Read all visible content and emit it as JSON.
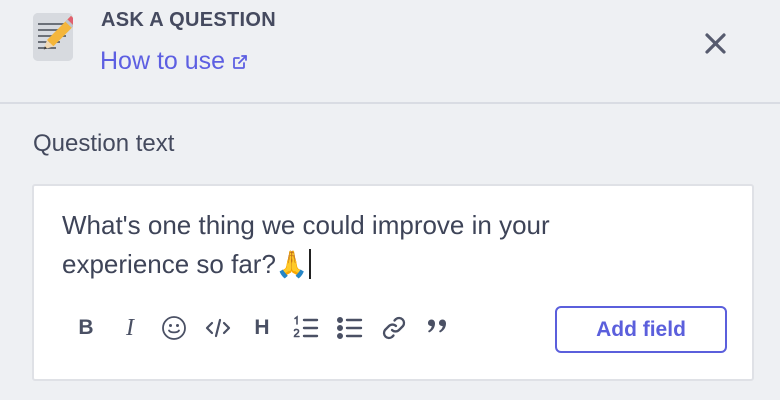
{
  "header": {
    "title": "ASK A QUESTION",
    "help_link": "How to use",
    "app_icon": "memo-pencil-icon",
    "close_icon": "close-icon"
  },
  "form": {
    "field_label": "Question text",
    "question_value": "What's one thing we could improve in your experience so far?🙏",
    "toolbar": [
      {
        "name": "bold",
        "icon": "bold-icon"
      },
      {
        "name": "italic",
        "icon": "italic-icon"
      },
      {
        "name": "emoji",
        "icon": "emoji-icon"
      },
      {
        "name": "code",
        "icon": "code-icon"
      },
      {
        "name": "heading",
        "icon": "heading-icon"
      },
      {
        "name": "ordered-list",
        "icon": "ordered-list-icon"
      },
      {
        "name": "bullet-list",
        "icon": "bullet-list-icon"
      },
      {
        "name": "link",
        "icon": "link-icon"
      },
      {
        "name": "quote",
        "icon": "quote-icon"
      }
    ],
    "toolbar_glyphs": {
      "bold": "B",
      "italic": "I",
      "heading": "H"
    },
    "add_field_label": "Add field"
  },
  "colors": {
    "accent": "#5b5fdc",
    "link": "#5d5fe2",
    "background": "#eef0f3",
    "text": "#3e4458"
  }
}
